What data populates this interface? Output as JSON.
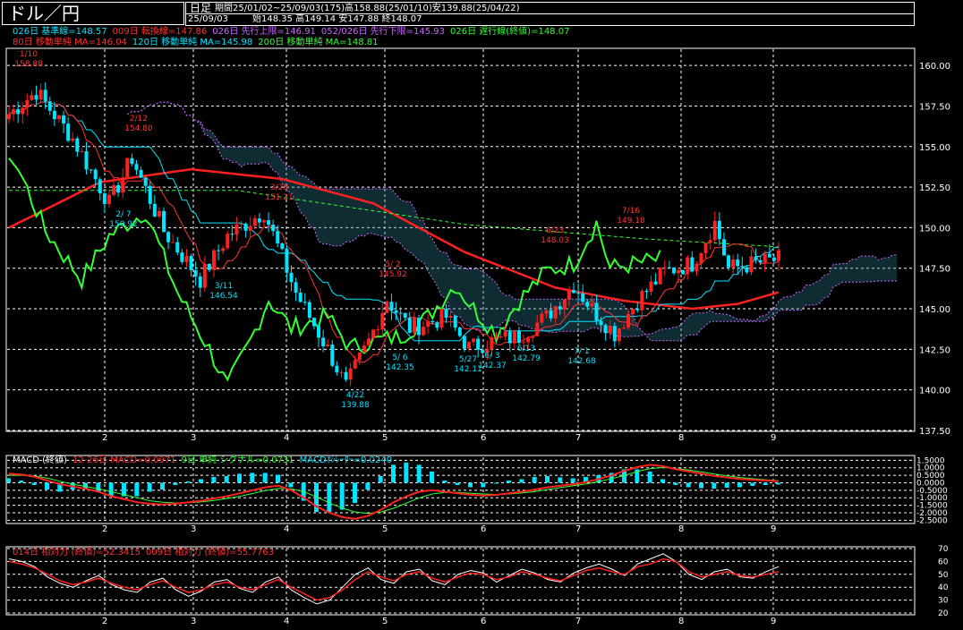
{
  "header": {
    "title": "ドル／円",
    "period_label": "日足",
    "period_info": "期間25/01/02~25/09/03(175)高158.88(25/01/10)安139.88(25/04/22)",
    "date": "25/09/03",
    "ohlc": "始148.35 高149.14 安147.88 終148.07"
  },
  "legend": {
    "line1": [
      {
        "text": "026日 基準線=148.57",
        "color": "#00e5ff"
      },
      {
        "text": "009日 転換線=147.86",
        "color": "#ff3333"
      },
      {
        "text": "026日 先行上限=146.91",
        "color": "#cc66ff"
      },
      {
        "text": "052/026日 先行下限=145.93",
        "color": "#cc66ff"
      },
      {
        "text": "026日 遅行線(終値)=148.07",
        "color": "#33ff33"
      }
    ],
    "line2": [
      {
        "text": "80日 移動単純 MA=146.04",
        "color": "#ff3333"
      },
      {
        "text": "120日 移動単純 MA=145.98",
        "color": "#00e5ff"
      },
      {
        "text": "200日 移動単純 MA=148.81",
        "color": "#33ff33"
      }
    ]
  },
  "macd_legend": [
    {
      "text": "MACD (終値)",
      "color": "#ffffff"
    },
    {
      "text": "12-26日 MACD=0.0971",
      "color": "#ff3333"
    },
    {
      "text": "9日 単純 シグナル=0.0731",
      "color": "#33ff33"
    },
    {
      "text": "MACDｵｼﾚｰﾀｰ=0.0240",
      "color": "#00e5ff"
    }
  ],
  "rsi_legend": [
    {
      "text": "014日 相対力 (終値)=52.3415",
      "color": "#ff3333"
    },
    {
      "text": "009日 相対力 (終値)=55.7763",
      "color": "#ff3333"
    }
  ],
  "colors": {
    "up": "#ff2020",
    "down": "#00e5ff",
    "ma80": "#ff2020",
    "ma200": "#33ff33",
    "kijun": "#00e5ff",
    "tenkan": "#ff3333",
    "chikou": "#33ff33",
    "cloud": "#cc66ff",
    "grid": "#ffffff"
  },
  "chart_data": [
    {
      "type": "candlestick",
      "title": "ドル／円",
      "x_tick_labels": [
        "2",
        "3",
        "4",
        "5",
        "6",
        "7",
        "8",
        "9"
      ],
      "ylim": [
        137.5,
        161.0
      ],
      "y_ticks": [
        137.5,
        140.0,
        142.5,
        145.0,
        147.5,
        150.0,
        152.5,
        155.0,
        157.5,
        160.0
      ],
      "y_tick_labels": [
        "137.50",
        "140.00",
        "142.50",
        "145.00",
        "147.50",
        "150.00",
        "152.50",
        "155.00",
        "157.50",
        "160.00"
      ],
      "grid": true,
      "annotations": [
        {
          "date": "1/10",
          "value": "158.88",
          "kind": "high"
        },
        {
          "date": "2/12",
          "value": "154.80",
          "kind": "high"
        },
        {
          "date": "2/ 7",
          "value": "150.92",
          "kind": "low"
        },
        {
          "date": "3/11",
          "value": "146.54",
          "kind": "low"
        },
        {
          "date": "3/28",
          "value": "151.21",
          "kind": "high"
        },
        {
          "date": "4/22",
          "value": "139.88",
          "kind": "low"
        },
        {
          "date": "5/ 2",
          "value": "145.92",
          "kind": "high"
        },
        {
          "date": "5/ 6",
          "value": "142.35",
          "kind": "low"
        },
        {
          "date": "5/27",
          "value": "142.11",
          "kind": "low"
        },
        {
          "date": "6/ 3",
          "value": "142.37",
          "kind": "low"
        },
        {
          "date": "6/13",
          "value": "142.79",
          "kind": "low"
        },
        {
          "date": "6/23",
          "value": "148.03",
          "kind": "high"
        },
        {
          "date": "7/ 1",
          "value": "142.68",
          "kind": "low"
        },
        {
          "date": "7/16",
          "value": "149.18",
          "kind": "high"
        }
      ]
    },
    {
      "type": "line",
      "title": "MACD (終値)",
      "x_tick_labels": [
        "2",
        "3",
        "4",
        "5",
        "6",
        "7",
        "8",
        "9"
      ],
      "ylim": [
        -2.6,
        1.7
      ],
      "y_tick_labels": [
        "1.5000",
        "1.0000",
        "0.5000",
        "0.0000",
        "-0.5000",
        "-1.0000",
        "-1.5000",
        "-2.0000",
        "-2.5000"
      ],
      "series": [
        {
          "name": "12-26日 MACD",
          "values": [
            0.6,
            0.55,
            0.4,
            0.15,
            -0.1,
            -0.25,
            -0.4,
            -0.6,
            -0.9,
            -1.1,
            -1.3,
            -1.4,
            -1.45,
            -1.4,
            -1.3,
            -1.2,
            -1.05,
            -0.9,
            -0.7,
            -0.5,
            -0.3,
            -0.2,
            -0.5,
            -1.0,
            -1.6,
            -2.0,
            -2.3,
            -2.4,
            -2.2,
            -1.8,
            -1.3,
            -0.9,
            -0.6,
            -0.5,
            -0.6,
            -0.7,
            -0.8,
            -0.85,
            -0.8,
            -0.7,
            -0.6,
            -0.45,
            -0.3,
            -0.2,
            -0.1,
            0.05,
            0.25,
            0.5,
            0.8,
            1.05,
            1.2,
            1.1,
            0.9,
            0.75,
            0.6,
            0.45,
            0.35,
            0.25,
            0.2,
            0.15,
            0.1
          ]
        },
        {
          "name": "9日 単純 シグナル",
          "values": [
            0.5,
            0.5,
            0.45,
            0.3,
            0.1,
            -0.1,
            -0.25,
            -0.4,
            -0.6,
            -0.8,
            -1.0,
            -1.2,
            -1.3,
            -1.35,
            -1.33,
            -1.28,
            -1.18,
            -1.05,
            -0.9,
            -0.72,
            -0.52,
            -0.38,
            -0.4,
            -0.6,
            -0.95,
            -1.35,
            -1.7,
            -1.95,
            -2.05,
            -1.95,
            -1.7,
            -1.35,
            -1.0,
            -0.75,
            -0.65,
            -0.65,
            -0.7,
            -0.75,
            -0.78,
            -0.75,
            -0.68,
            -0.58,
            -0.45,
            -0.32,
            -0.2,
            -0.08,
            0.08,
            0.28,
            0.5,
            0.75,
            0.95,
            1.02,
            0.95,
            0.85,
            0.72,
            0.58,
            0.46,
            0.35,
            0.27,
            0.2,
            0.14
          ]
        }
      ]
    },
    {
      "type": "line",
      "title": "相対力 (終値)",
      "x_tick_labels": [
        "2",
        "3",
        "4",
        "5",
        "6",
        "7",
        "8",
        "9"
      ],
      "ylim": [
        20,
        70
      ],
      "y_ticks": [
        20,
        30,
        40,
        50,
        60,
        70
      ],
      "y_tick_labels": [
        "20",
        "30",
        "40",
        "50",
        "60",
        "70"
      ],
      "series": [
        {
          "name": "014日 相対力",
          "values": [
            60,
            58,
            55,
            50,
            45,
            42,
            44,
            47,
            43,
            40,
            38,
            42,
            45,
            40,
            36,
            38,
            42,
            44,
            40,
            38,
            42,
            46,
            40,
            35,
            30,
            32,
            38,
            46,
            52,
            48,
            45,
            50,
            52,
            47,
            44,
            48,
            51,
            50,
            46,
            48,
            52,
            50,
            47,
            45,
            49,
            53,
            55,
            52,
            50,
            56,
            58,
            62,
            60,
            52,
            48,
            50,
            52,
            49,
            48,
            50,
            52
          ]
        },
        {
          "name": "009日 相対力",
          "values": [
            62,
            60,
            56,
            48,
            43,
            40,
            45,
            49,
            42,
            38,
            36,
            44,
            47,
            38,
            33,
            37,
            44,
            46,
            39,
            36,
            44,
            48,
            38,
            32,
            27,
            30,
            40,
            50,
            55,
            46,
            43,
            52,
            54,
            45,
            42,
            50,
            53,
            51,
            44,
            49,
            54,
            51,
            46,
            44,
            51,
            55,
            58,
            54,
            49,
            58,
            62,
            66,
            60,
            50,
            46,
            52,
            54,
            48,
            47,
            52,
            56
          ]
        }
      ]
    }
  ]
}
